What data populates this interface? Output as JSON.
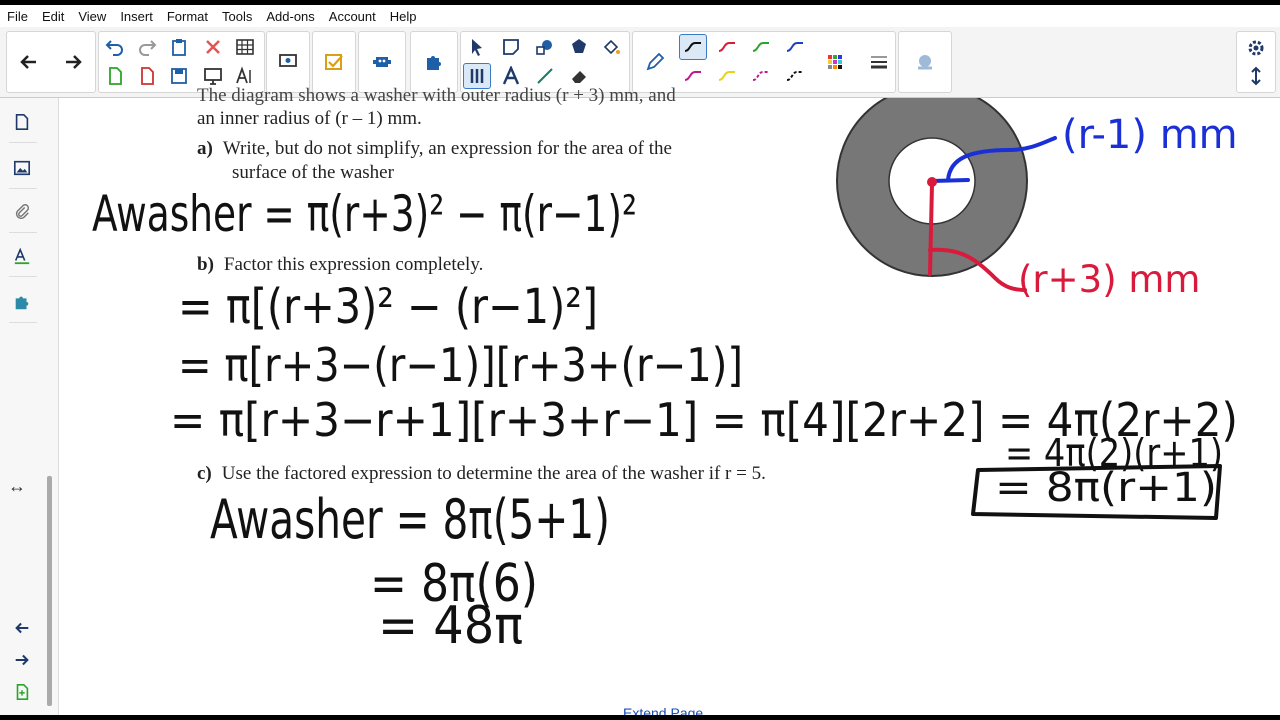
{
  "menu": [
    "File",
    "Edit",
    "View",
    "Insert",
    "Format",
    "Tools",
    "Add-ons",
    "Account",
    "Help"
  ],
  "toolbar": {
    "groups": [
      "navigation",
      "edit",
      "select",
      "annotate",
      "pen-styles",
      "misc"
    ],
    "pen_colors": [
      "#111111",
      "#d81b3c",
      "#2aa52a",
      "#1f3fbf",
      "#c2188f",
      "#e8d21b",
      "#c2188f",
      "#111111"
    ]
  },
  "question": {
    "intro_line1": "The diagram shows a washer with outer radius (r + 3) mm, and",
    "intro_line2": "an inner radius of (r – 1) mm.",
    "a_label": "a)",
    "a_text_1": "Write, but do not simplify, an expression for the area of the",
    "a_text_2": "surface of the washer",
    "b_label": "b)",
    "b_text": "Factor this expression completely.",
    "c_label": "c)",
    "c_text": "Use the factored expression to determine the area of the washer if r = 5."
  },
  "handwriting": {
    "a_line": "Awasher = π(r+3)² − π(r−1)²",
    "b_line1": "= π[(r+3)² − (r−1)²]",
    "b_line2": "= π[r+3−(r−1)][r+3+(r−1)]",
    "b_line3": "= π[r+3−r+1][r+3+r−1] = π[4][2r+2] = 4π(2r+2)",
    "b_line4": "= 4π(2)(r+1)",
    "b_boxed": "= 8π(r+1)",
    "c_line1": "Awasher = 8π(5+1)",
    "c_line2": "= 8π(6)",
    "c_line3": "= 48π",
    "inner_label": "(r-1) mm",
    "outer_label": "(r+3) mm"
  },
  "footer": {
    "extend_page": "Extend Page"
  }
}
